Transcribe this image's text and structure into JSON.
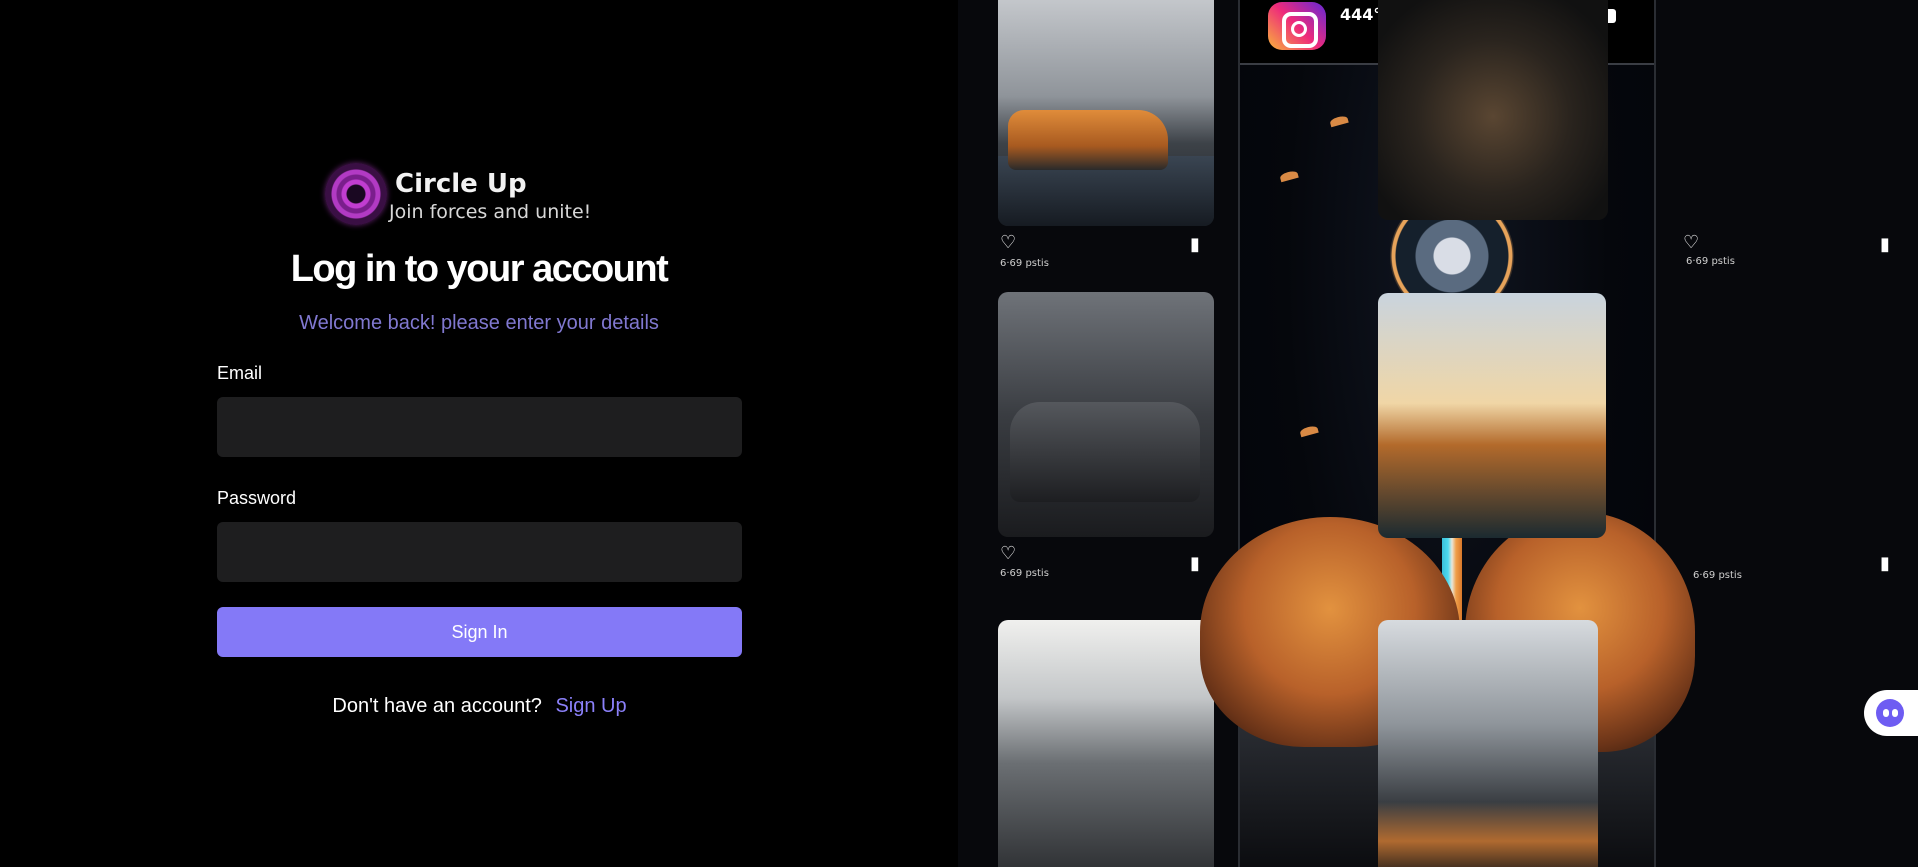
{
  "brand": {
    "name": "Circle Up",
    "tagline": "Join forces and unite!",
    "logo_icon": "circle-up-logo"
  },
  "login": {
    "title": "Log in to your account",
    "subtitle": "Welcome back! please enter your details",
    "email_label": "Email",
    "email_value": "",
    "password_label": "Password",
    "password_value": "",
    "submit_label": "Sign In",
    "signup_prompt": "Don't have an account?",
    "signup_link": "Sign Up"
  },
  "artwork": {
    "post_username": "444°4",
    "post_icon": "instagram-icon",
    "tile_counts": [
      "6·69 pstis",
      "6·69 pstis",
      "6·69 pstis",
      "6·69 pstis"
    ]
  },
  "colors": {
    "accent": "#8479f7",
    "link": "#8b80f9",
    "subtitle": "#8078d0",
    "input_bg": "#1e1e1f",
    "page_bg": "#000000"
  }
}
